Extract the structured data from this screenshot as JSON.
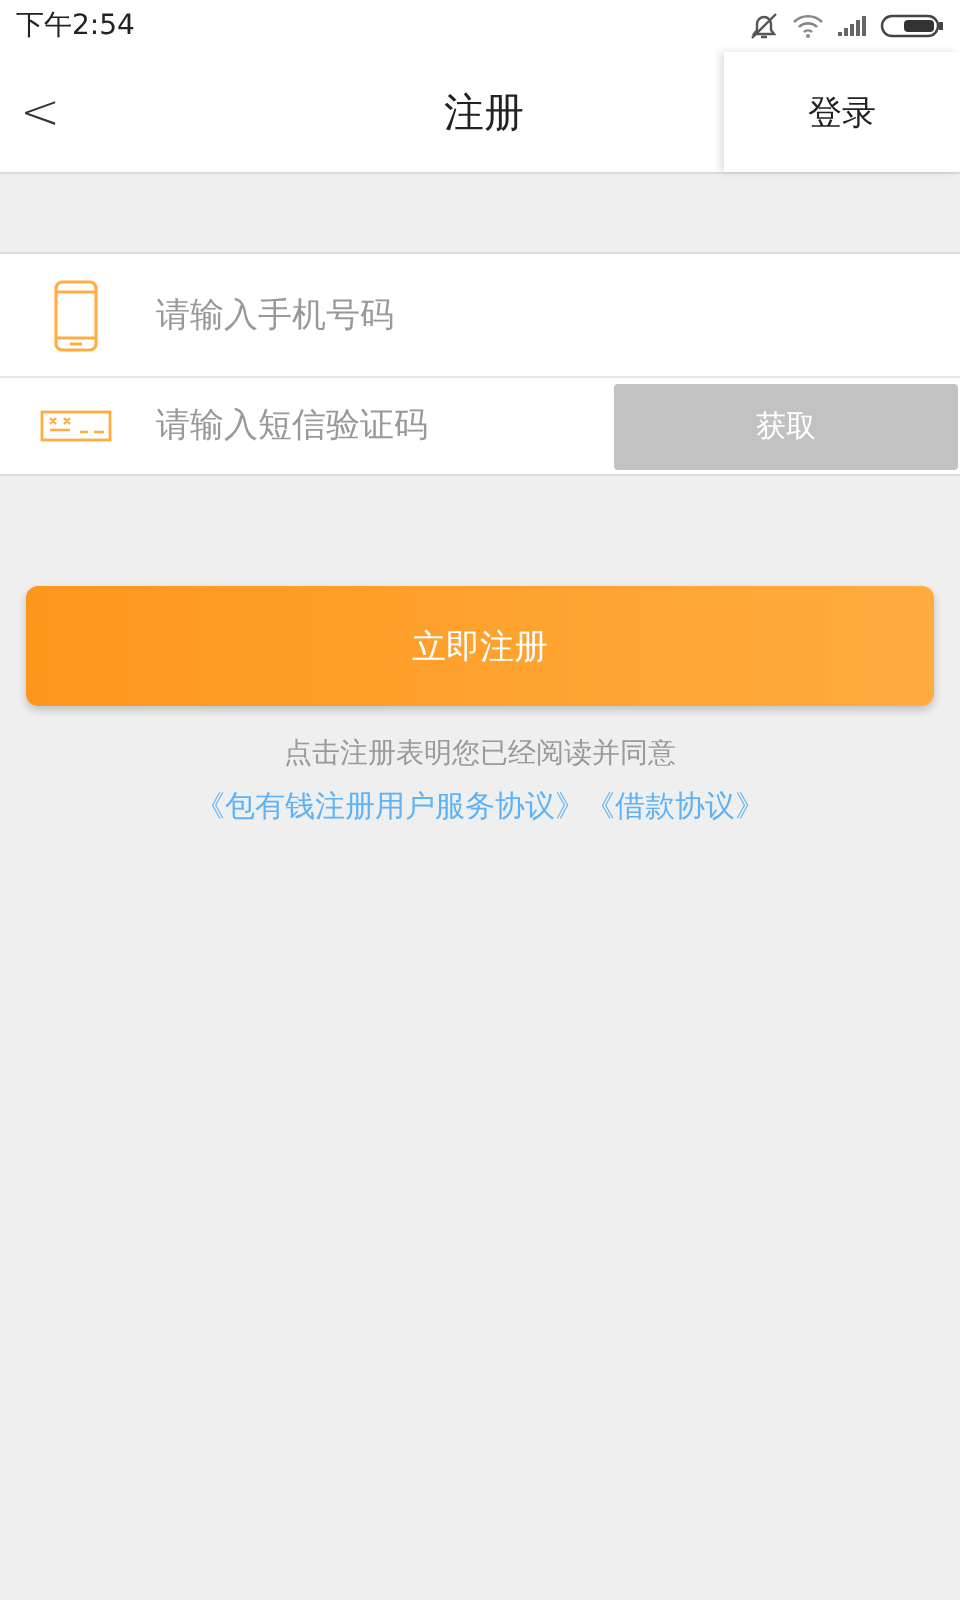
{
  "status_bar": {
    "time": "下午2:54"
  },
  "header": {
    "back": "<",
    "title": "注册",
    "action": "登录"
  },
  "fields": [
    {
      "kind": "phone",
      "placeholder": "请输入手机号码"
    },
    {
      "kind": "code",
      "placeholder": "请输入短信验证码",
      "button": {
        "label": "获取",
        "disabled": true
      }
    }
  ],
  "submit": "立即注册",
  "agreement": {
    "text": "点击注册表明您已经阅读并同意",
    "links": [
      "《包有钱注册用户服务协议》",
      "《借款协议》"
    ]
  }
}
